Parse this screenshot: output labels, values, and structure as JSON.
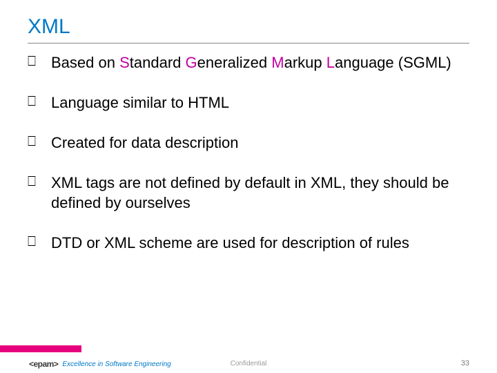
{
  "title": "XML",
  "bullets": [
    {
      "segments": [
        {
          "t": "Based on "
        },
        {
          "t": "S",
          "hl": true
        },
        {
          "t": "tandard "
        },
        {
          "t": "G",
          "hl": true
        },
        {
          "t": "eneralized "
        },
        {
          "t": "M",
          "hl": true
        },
        {
          "t": "arkup "
        },
        {
          "t": "L",
          "hl": true
        },
        {
          "t": "anguage (SGML)"
        }
      ]
    },
    {
      "segments": [
        {
          "t": "Language similar to HTML"
        }
      ]
    },
    {
      "segments": [
        {
          "t": "Created for data description"
        }
      ]
    },
    {
      "segments": [
        {
          "t": "XML tags are not defined by default in XML, they should be defined by ourselves"
        }
      ]
    },
    {
      "segments": [
        {
          "t": "DTD or XML scheme are used for description of rules"
        }
      ]
    }
  ],
  "footer": {
    "logo_text": "<epam>",
    "tagline": "Excellence in Software Engineering",
    "confidential": "Confidential",
    "page": "33"
  }
}
